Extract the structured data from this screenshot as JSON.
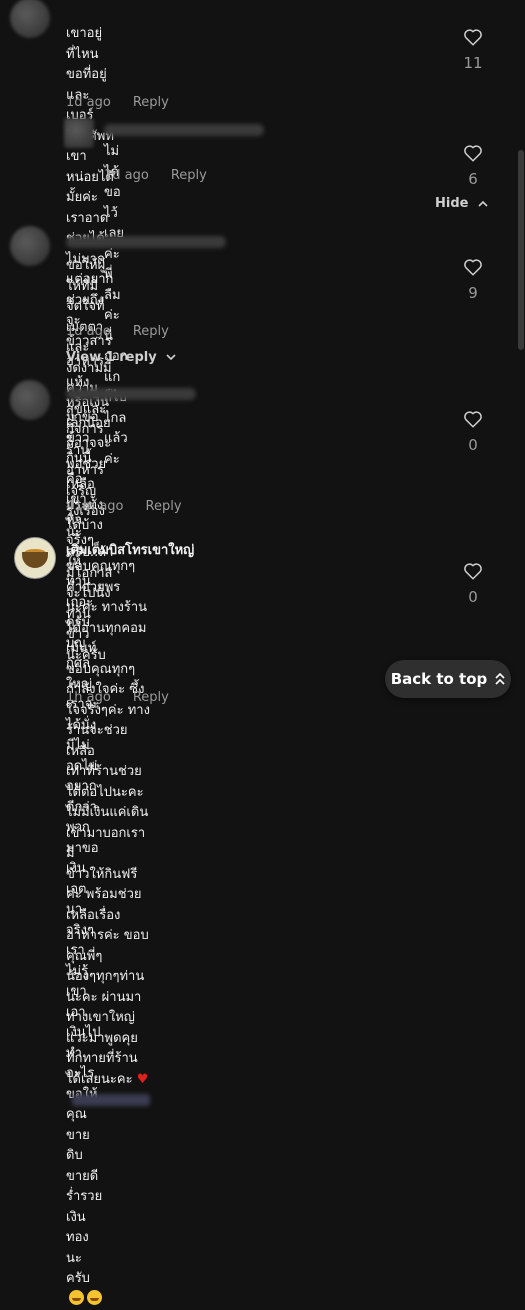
{
  "comments": [
    {
      "text": "เขาอยู่ที่ไหนขอที่อยู่และเบอร์โทรศัพท์เขาหน่อยได้มั้ยค่ะ\nเราอาดช่วยได้ไม่มากแต่อยากช่วยถึงจะข้าวสารอาหารแห้ง\nหรือเงินเล็กน้อยก็อาจจะพอช่วยเหลือประทังได้บ้าง",
      "time": "1d ago",
      "reply": "Reply",
      "likes": "11"
    },
    {
      "text": "ไม่ได้ขอไว้เลยค่ะพี่ ลืมค่ะ นี่ถอกแกก็ไปไกลแล้วค่ะ",
      "time": "1d ago",
      "reply": "Reply",
      "likes": "6"
    },
    {
      "text": "ขอให้ผู้ให้ที่มีจิตใจที่เมตตาและงดงามมีความสุขและกิจการ\nร้านอาหารเจริญรุ่งเรืองนะครับ..ถ้ามีโอกาสจะไปนั่งทานข้าว\nนะครับ",
      "time": "1d ago",
      "reply": "Reply",
      "likes": "9"
    },
    {
      "text": "มาขอข้าวกินนี้คือเขาหิวจริงๆให้ทานเถอะครับบุญกุศลใหญ่\nเราจะได้นั่งมีไม่อดไม่อยากดีกว่าพวกมาขอเงินเจตนาจริงๆ\nเราไม่รู้เขาเอาเงินไปทำอะไรขอให้คุณขายดิบขายดีร่ำรวย\nเงินทองนะครับ",
      "time": "41m ago",
      "reply": "Reply",
      "likes": "0"
    },
    {
      "author": "เติมเต็มบิสโทรเขาใหญ่",
      "text": "ขอบคุณทุกๆคำอวยพร นะคะ ทางร้านได้อ่านทุกคอมเม้นท์\nขอบคุณทุกๆกำลังใจค่ะ ซึ้งใจจริงๆค่ะ ทางร้านจะช่วยเหลือ\nเท่าที่ร้านช่วยได้ต่อไปนะคะ ไม่มีเงินแค่เดินเข้ามาบอกเรามี\nข้าวให้กินฟรีค่ะ พร้อมช่วยเหลือเรื่องอาหารค่ะ ขอบคุณพี่ๆ\nน้องๆทุกๆท่านนะคะ ผ่านมาทางเขาใหญ่ แวะมาพูดคุย\nทักทายที่ร้านได้เลยนะคะ",
      "time": "1h ago",
      "reply": "Reply",
      "likes": "0"
    }
  ],
  "hide_label": "Hide",
  "view_reply_label": "View 1 reply",
  "back_to_top_label": "Back to top",
  "icons": {
    "like": "heart-outline-icon",
    "chevron_up": "chevron-up-icon",
    "chevron_down": "chevron-down-icon",
    "back_to_top": "double-chevron-up-icon"
  }
}
